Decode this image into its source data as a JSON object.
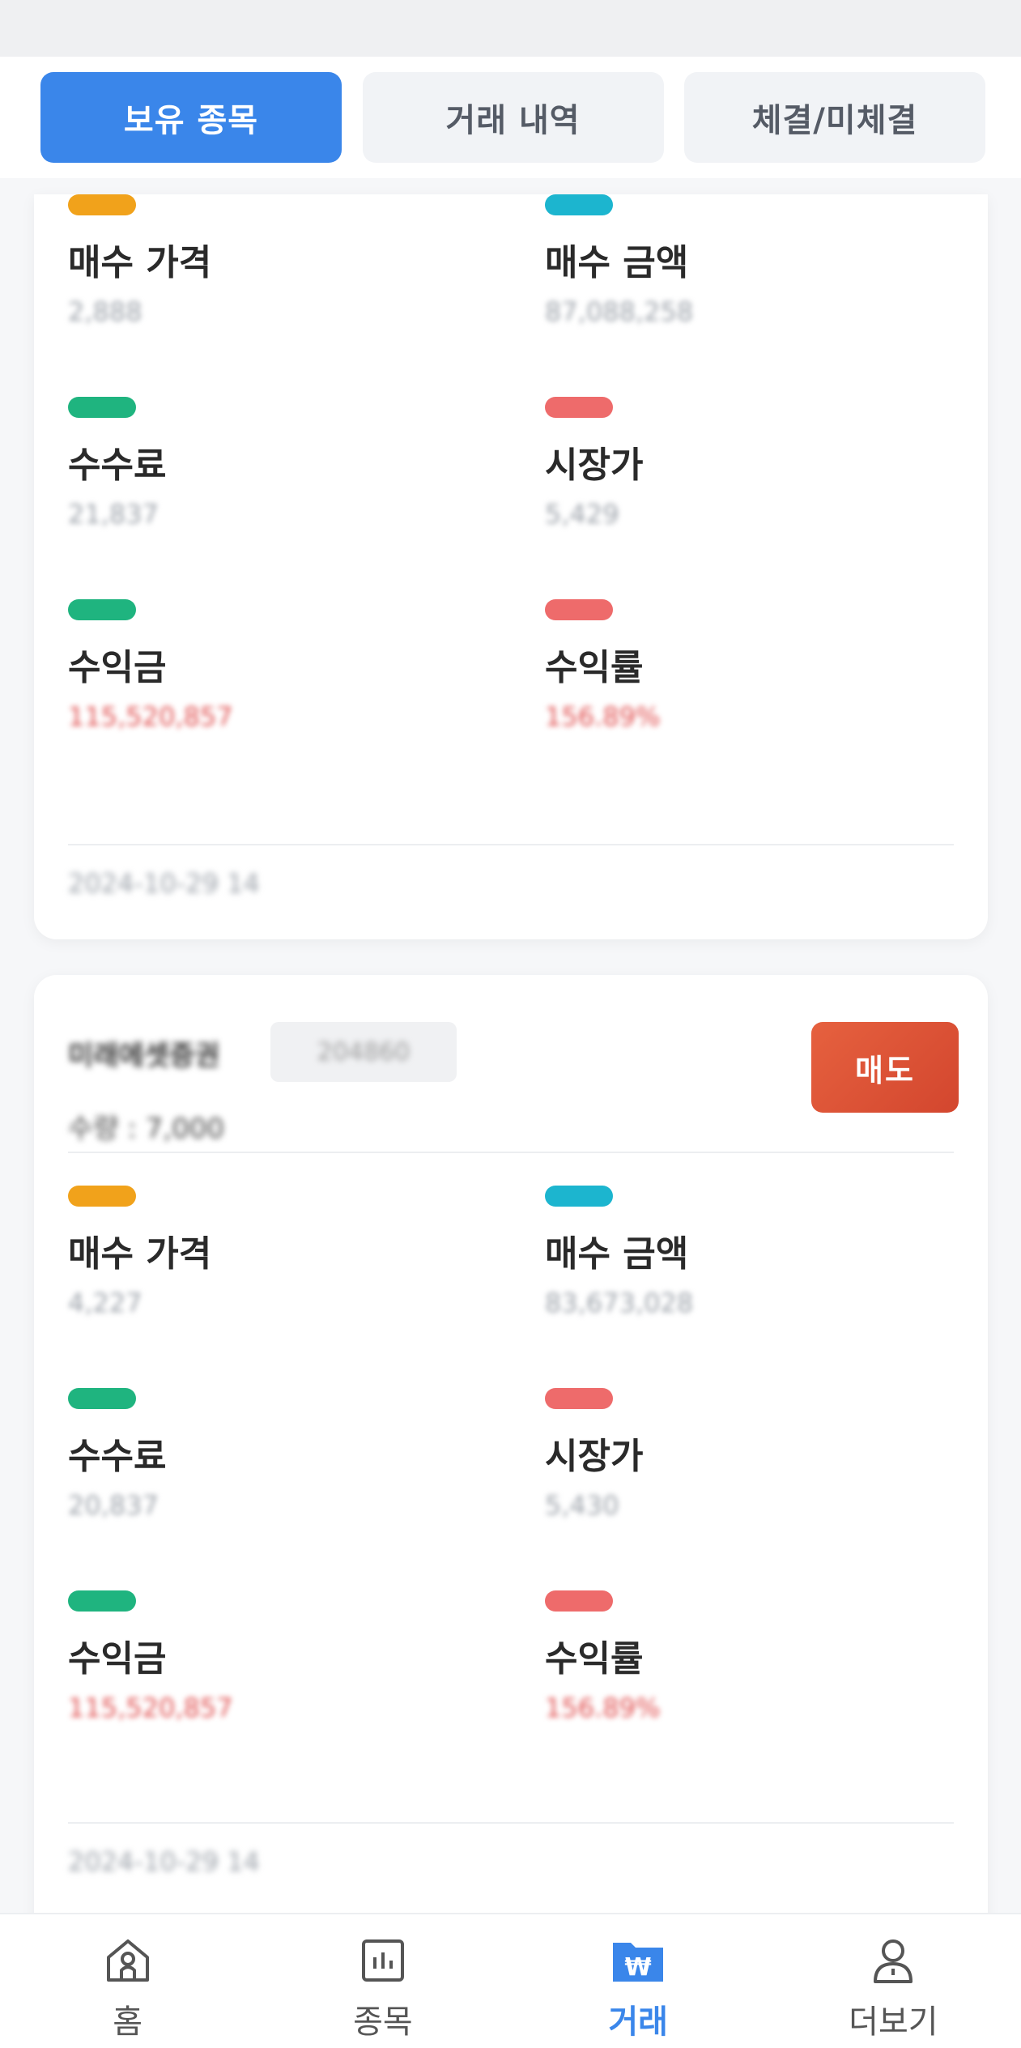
{
  "tabs": [
    {
      "label": "보유 종목",
      "active": true
    },
    {
      "label": "거래 내역",
      "active": false
    },
    {
      "label": "체결/미체결",
      "active": false
    }
  ],
  "colors": {
    "accent": "#3a86ea",
    "sell": "#d94a32",
    "pill_orange": "#f1a21b",
    "pill_cyan": "#1cb5cf",
    "pill_green": "#1fb47f",
    "pill_red": "#ee6b6b",
    "profit_red": "#e04e4e"
  },
  "cards": [
    {
      "metrics": {
        "buy_price": {
          "label": "매수 가격",
          "value": "2,888"
        },
        "buy_amount": {
          "label": "매수 금액",
          "value": "87,088,258"
        },
        "fee": {
          "label": "수수료",
          "value": "21,837"
        },
        "market_price": {
          "label": "시장가",
          "value": "5,429"
        },
        "profit": {
          "label": "수익금",
          "value": "115,520,857"
        },
        "profit_rate": {
          "label": "수익률",
          "value": "156.89%"
        }
      },
      "timestamp": "2024-10-29 14"
    },
    {
      "stock_name": "미래에셋증권",
      "stock_code": "204860",
      "quantity": "수량 : 7,000",
      "sell_label": "매도",
      "metrics": {
        "buy_price": {
          "label": "매수 가격",
          "value": "4,227"
        },
        "buy_amount": {
          "label": "매수 금액",
          "value": "83,673,028"
        },
        "fee": {
          "label": "수수료",
          "value": "20,837"
        },
        "market_price": {
          "label": "시장가",
          "value": "5,430"
        },
        "profit": {
          "label": "수익금",
          "value": "115,520,857"
        },
        "profit_rate": {
          "label": "수익률",
          "value": "156.89%"
        }
      },
      "timestamp": "2024-10-29 14"
    }
  ],
  "bottom_nav": [
    {
      "label": "홈",
      "icon": "home-icon",
      "active": false
    },
    {
      "label": "종목",
      "icon": "chart-icon",
      "active": false
    },
    {
      "label": "거래",
      "icon": "won-folder-icon",
      "active": true
    },
    {
      "label": "더보기",
      "icon": "person-icon",
      "active": false
    }
  ]
}
